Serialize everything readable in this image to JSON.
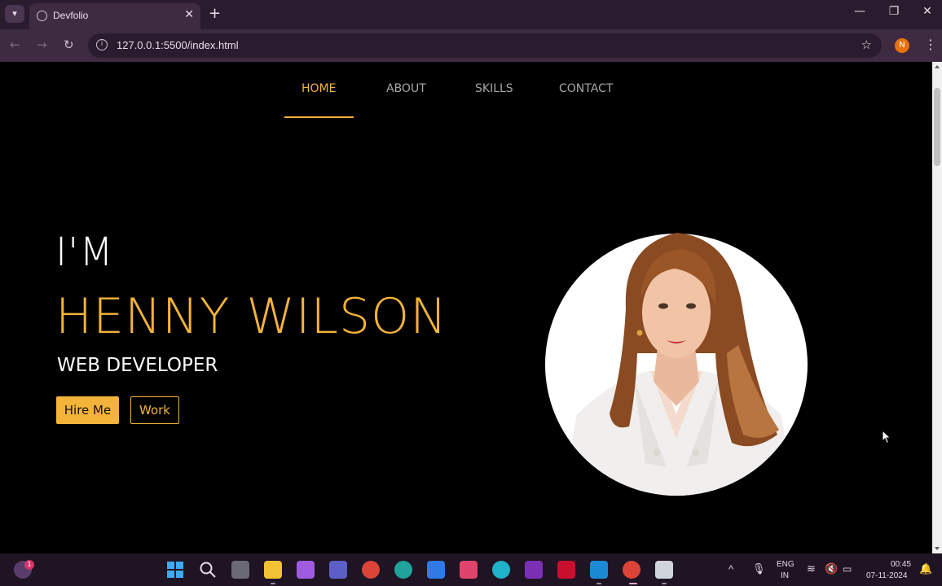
{
  "browser": {
    "tab_title": "Devfolio",
    "url": "127.0.0.1:5500/index.html",
    "profile_initial": "N"
  },
  "nav": {
    "items": [
      "HOME",
      "ABOUT",
      "SKILLS",
      "CONTACT"
    ],
    "active": "HOME"
  },
  "hero": {
    "intro": "I'M",
    "name": "HENNY WILSON",
    "role": "WEB DEVELOPER",
    "hire_label": "Hire Me",
    "work_label": "Work"
  },
  "colors": {
    "accent": "#f4b33b",
    "background": "#000000",
    "chrome": "#3e2b42"
  },
  "taskbar": {
    "language": "ENG",
    "region": "IN",
    "time": "00:45",
    "date": "07-11-2024",
    "notification_count": "1",
    "icons": [
      "start-icon",
      "search-icon",
      "task-view-icon",
      "file-explorer-icon",
      "copilot-icon",
      "teams-icon",
      "chrome-icon",
      "edge-icon",
      "todo-icon",
      "figma-icon",
      "canva-icon",
      "onenote-icon",
      "mcafee-icon",
      "vscode-icon",
      "chrome-profile-icon",
      "snipping-tool-icon"
    ]
  }
}
